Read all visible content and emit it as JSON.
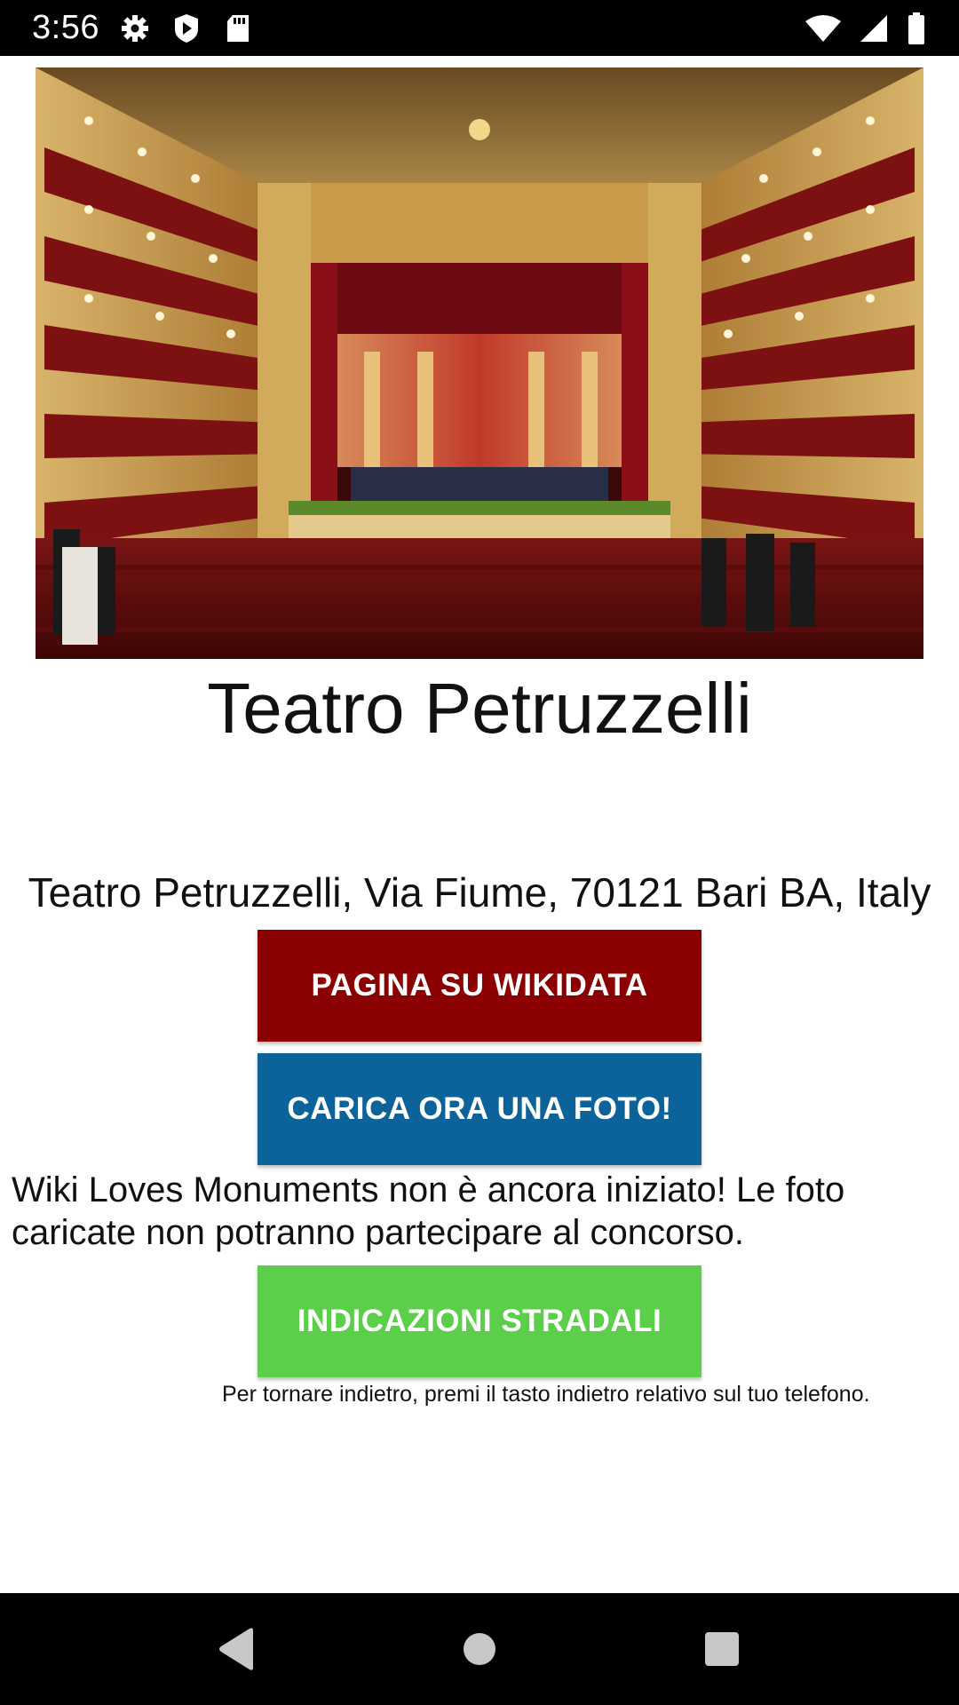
{
  "status_bar": {
    "time": "3:56",
    "left_icons": [
      "gear-icon",
      "play-shield-icon",
      "sd-card-icon"
    ],
    "right_icons": [
      "wifi-icon",
      "signal-icon",
      "battery-icon"
    ]
  },
  "place": {
    "title": "Teatro Petruzzelli",
    "address": "Teatro Petruzzelli, Via Fiume, 70121 Bari BA, Italy"
  },
  "buttons": {
    "wikidata_label": "PAGINA SU WIKIDATA",
    "upload_label": "CARICA ORA UNA FOTO!",
    "directions_label": "INDICAZIONI STRADALI"
  },
  "notice": "Wiki Loves Monuments non è ancora iniziato! Le foto caricate non potranno partecipare al concorso.",
  "back_hint": "Per tornare indietro, premi il tasto indietro relativo sul tuo telefono.",
  "colors": {
    "wikidata": "#8b0000",
    "upload": "#0b6399",
    "directions": "#5bce4a"
  },
  "nav_bar": {
    "icons": [
      "back-icon",
      "home-icon",
      "recents-icon"
    ]
  }
}
